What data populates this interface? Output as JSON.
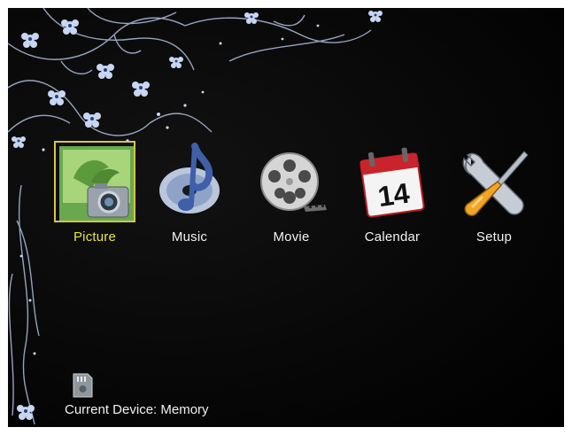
{
  "menu": {
    "items": [
      {
        "label": "Picture",
        "icon": "picture-icon",
        "selected": true
      },
      {
        "label": "Music",
        "icon": "music-icon",
        "selected": false
      },
      {
        "label": "Movie",
        "icon": "movie-icon",
        "selected": false
      },
      {
        "label": "Calendar",
        "icon": "calendar-icon",
        "selected": false
      },
      {
        "label": "Setup",
        "icon": "setup-icon",
        "selected": false
      }
    ],
    "calendar_day": "14"
  },
  "status": {
    "device_label": "Current Device: Memory",
    "device_icon": "memory-card-icon"
  },
  "colors": {
    "background": "#000000",
    "label": "#f1f1f1",
    "selected_label": "#e8e24a",
    "selection_frame": "#d7c640",
    "ornament": "#b9c9e8"
  }
}
